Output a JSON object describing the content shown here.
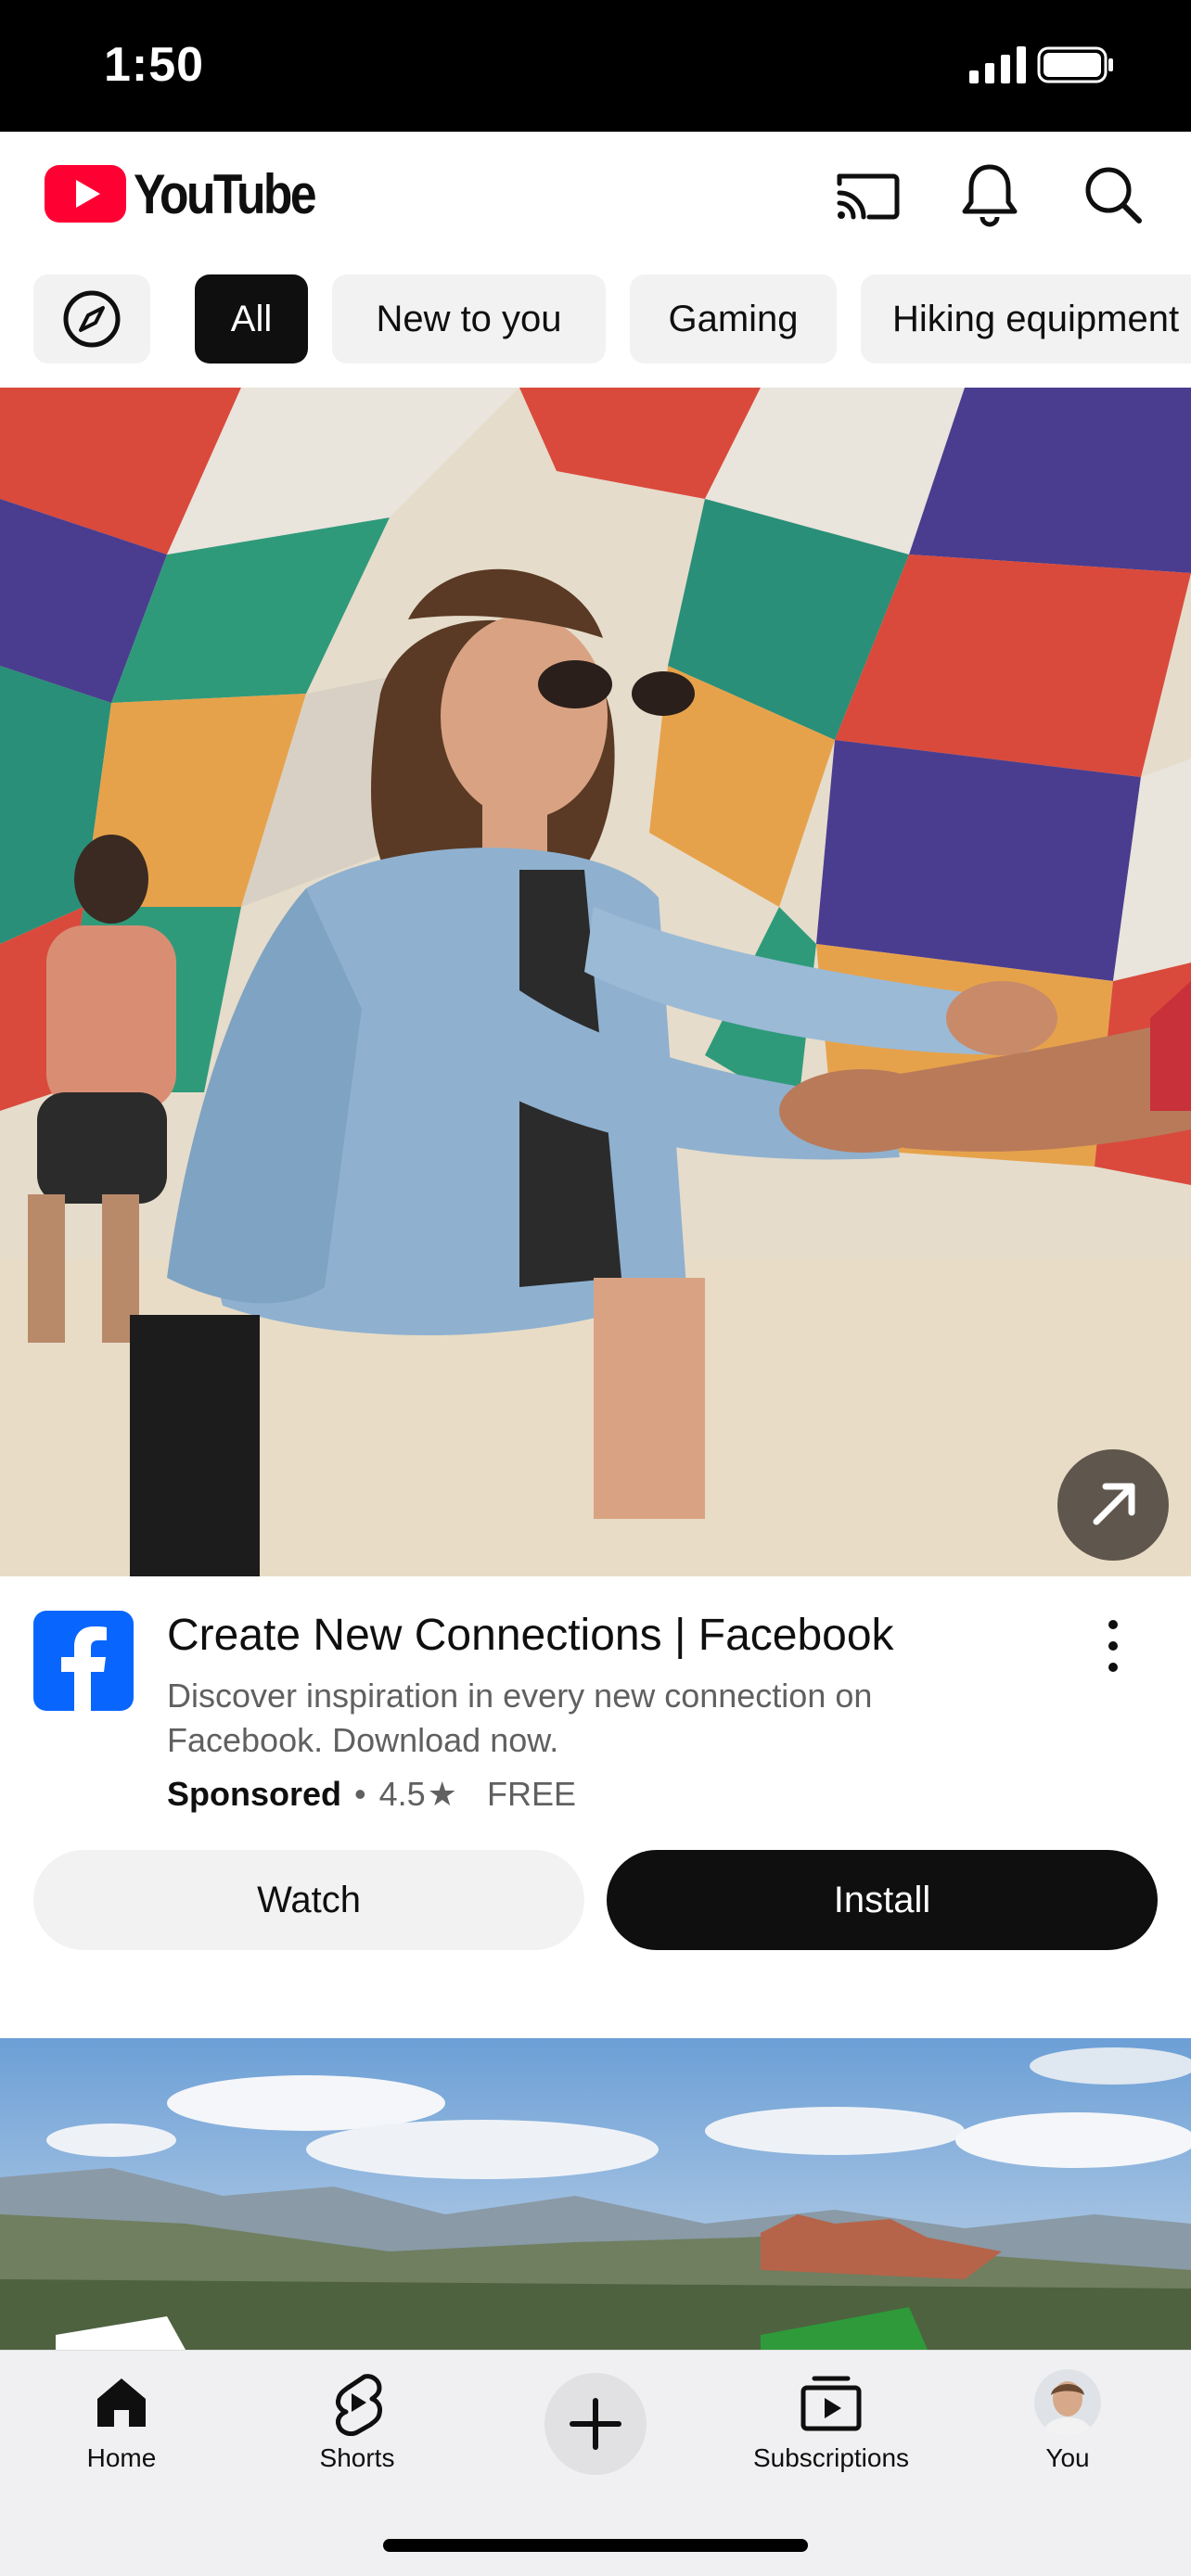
{
  "status_bar": {
    "time": "1:50"
  },
  "header": {
    "logo_text": "YouTube",
    "icons": [
      "cast-icon",
      "bell-icon",
      "search-icon"
    ]
  },
  "chips": [
    "All",
    "New to you",
    "Gaming",
    "Hiking equipment"
  ],
  "ad": {
    "title": "Create New Connections | Facebook",
    "description": "Discover inspiration in every new connection on Facebook. Download now.",
    "sponsored": "Sponsored",
    "separator": "•",
    "rating": "4.5",
    "star": "★",
    "price": "FREE",
    "watch_label": "Watch",
    "install_label": "Install"
  },
  "bottom_nav": {
    "home": "Home",
    "shorts": "Shorts",
    "subscriptions": "Subscriptions",
    "you": "You"
  },
  "colors": {
    "youtube_red": "#ff0033",
    "facebook_blue": "#0866ff",
    "chip_active": "#0f0f0f",
    "chip_bg": "#f2f2f2"
  }
}
